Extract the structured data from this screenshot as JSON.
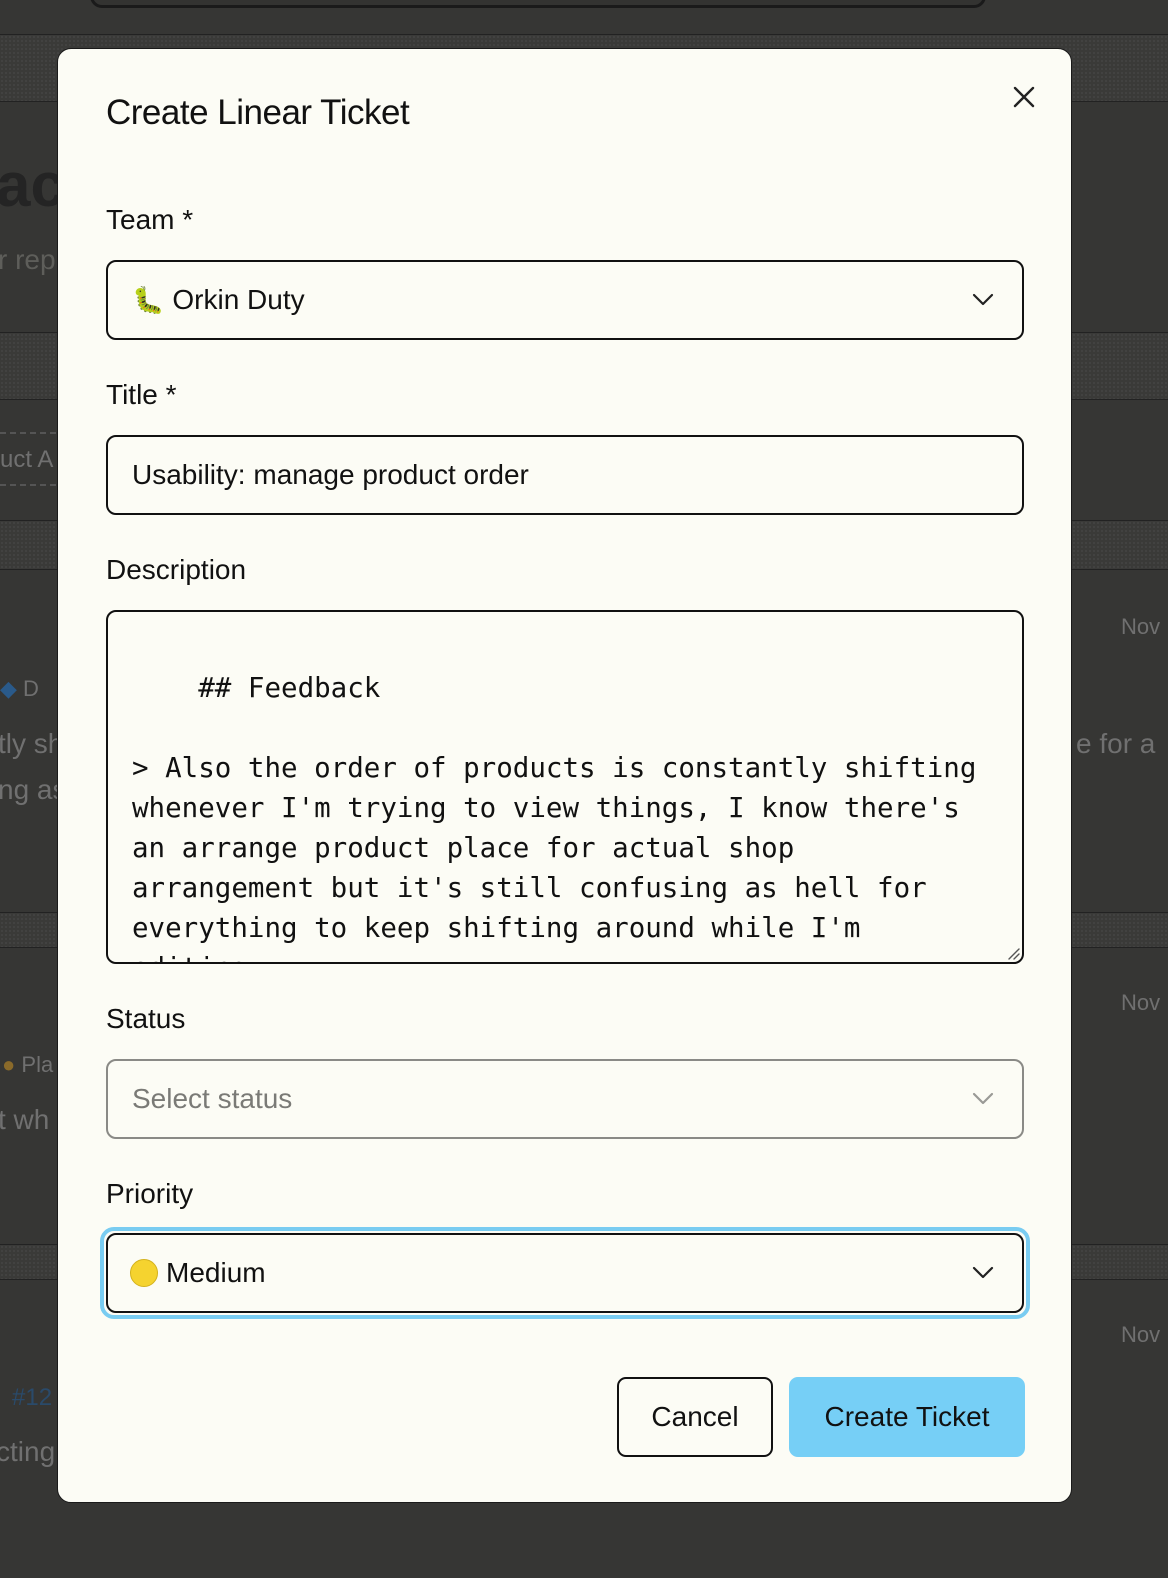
{
  "background": {
    "heading_fragment": "ack",
    "sub_fragment": "r rep",
    "tab_fragment": "uct A",
    "row1": {
      "date": "Nov",
      "tag": "D",
      "line1": "tly sh",
      "line2": "ng as",
      "right_text": "e for a"
    },
    "row2": {
      "date": "Nov",
      "tag": "Pla",
      "line1": "t wh"
    },
    "row3": {
      "date": "Nov",
      "tag": "#12",
      "line1": "cting"
    }
  },
  "modal": {
    "title": "Create Linear Ticket",
    "close_icon": "close-icon",
    "team": {
      "label": "Team *",
      "icon": "caterpillar-emoji",
      "value": "Orkin Duty"
    },
    "title_field": {
      "label": "Title *",
      "value": "Usability: manage product order"
    },
    "description": {
      "label": "Description",
      "value": "## Feedback\n\n> Also the order of products is constantly shifting\nwhenever I'm trying to view things, I know there's\nan arrange product place for actual shop\narrangement but it's still confusing as hell for\neverything to keep shifting around while I'm\nediting."
    },
    "status": {
      "label": "Status",
      "placeholder": "Select status"
    },
    "priority": {
      "label": "Priority",
      "icon": "yellow-circle-icon",
      "value": "Medium"
    },
    "buttons": {
      "cancel": "Cancel",
      "create": "Create Ticket"
    }
  },
  "colors": {
    "accent": "#76cff6",
    "focus_ring": "#79ccf1",
    "modal_bg": "#fcfcf5",
    "overlay": "#363634"
  }
}
